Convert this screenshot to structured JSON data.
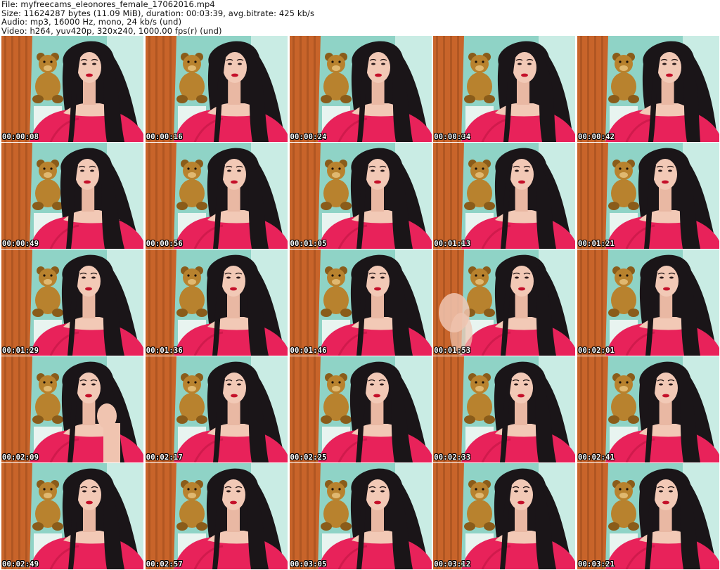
{
  "header": {
    "file_line": "File: myfreecams_eleonores_female_17062016.mp4",
    "size_line": "Size: 11624287 bytes (11.09 MiB), duration: 00:03:39, avg.bitrate: 425 kb/s",
    "audio_line": "Audio: mp3, 16000 Hz, mono, 24 kb/s (und)",
    "video_line": "Video: h264, yuv420p, 320x240, 1000.00 fps(r) (und)"
  },
  "frames": [
    {
      "time": "00:00:08",
      "pose": 0.0,
      "hand": false
    },
    {
      "time": "00:00:16",
      "pose": 0.2,
      "hand": false
    },
    {
      "time": "00:00:24",
      "pose": 0.1,
      "hand": false
    },
    {
      "time": "00:00:34",
      "pose": 0.5,
      "hand": false
    },
    {
      "time": "00:00:42",
      "pose": 0.6,
      "hand": false
    },
    {
      "time": "00:00:49",
      "pose": -0.3,
      "hand": false
    },
    {
      "time": "00:00:56",
      "pose": 0.1,
      "hand": false
    },
    {
      "time": "00:01:05",
      "pose": 0.0,
      "hand": false
    },
    {
      "time": "00:01:13",
      "pose": 0.1,
      "hand": false
    },
    {
      "time": "00:01:21",
      "pose": 0.0,
      "hand": false
    },
    {
      "time": "00:01:29",
      "pose": -0.1,
      "hand": false
    },
    {
      "time": "00:01:36",
      "pose": 0.0,
      "hand": false
    },
    {
      "time": "00:01:46",
      "pose": 0.0,
      "hand": false
    },
    {
      "time": "00:01:53",
      "pose": 0.1,
      "hand": true
    },
    {
      "time": "00:02:01",
      "pose": 0.2,
      "hand": false
    },
    {
      "time": "00:02:09",
      "pose": -0.1,
      "hand": true
    },
    {
      "time": "00:02:17",
      "pose": 0.1,
      "hand": false
    },
    {
      "time": "00:02:25",
      "pose": -0.1,
      "hand": false
    },
    {
      "time": "00:02:33",
      "pose": 0.0,
      "hand": false
    },
    {
      "time": "00:02:41",
      "pose": 0.1,
      "hand": false
    },
    {
      "time": "00:02:49",
      "pose": 0.0,
      "hand": false
    },
    {
      "time": "00:02:57",
      "pose": 0.0,
      "hand": false
    },
    {
      "time": "00:03:05",
      "pose": 0.0,
      "hand": false
    },
    {
      "time": "00:03:12",
      "pose": 0.0,
      "hand": false
    },
    {
      "time": "00:03:21",
      "pose": 0.1,
      "hand": false
    }
  ],
  "colors": {
    "wall": "#8fd3c6",
    "curtain": "#c8642a",
    "curtain_dark": "#9c4a1c",
    "bear": "#b8822e",
    "bear_dark": "#8a5c1a",
    "shirt": "#e8225a",
    "shirt_dark": "#b8123e",
    "skin": "#f2c9b6",
    "hair": "#1a1518",
    "lips": "#c4102a",
    "timestamp_text": "#ffffff",
    "timestamp_outline": "#000000"
  }
}
